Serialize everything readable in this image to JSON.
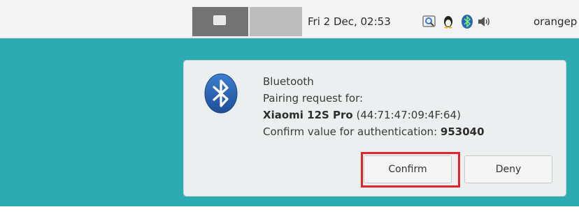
{
  "panel": {
    "clock": "Fri  2 Dec, 02:53",
    "user": "orangep",
    "tray_icons": [
      "network-icon",
      "tux-icon",
      "bluetooth-icon",
      "volume-icon"
    ]
  },
  "notification": {
    "title": "Bluetooth",
    "line1": "Pairing request for:",
    "device_name": "Xiaomi 12S Pro",
    "device_address": "(44:71:47:09:4F:64)",
    "confirm_text": "Confirm value for authentication:",
    "passkey": "953040",
    "buttons": {
      "confirm": "Confirm",
      "deny": "Deny"
    },
    "highlight_color": "#e2232a"
  },
  "colors": {
    "desktop": "#2eaab2",
    "bluetooth_blue": "#2a64b5"
  }
}
